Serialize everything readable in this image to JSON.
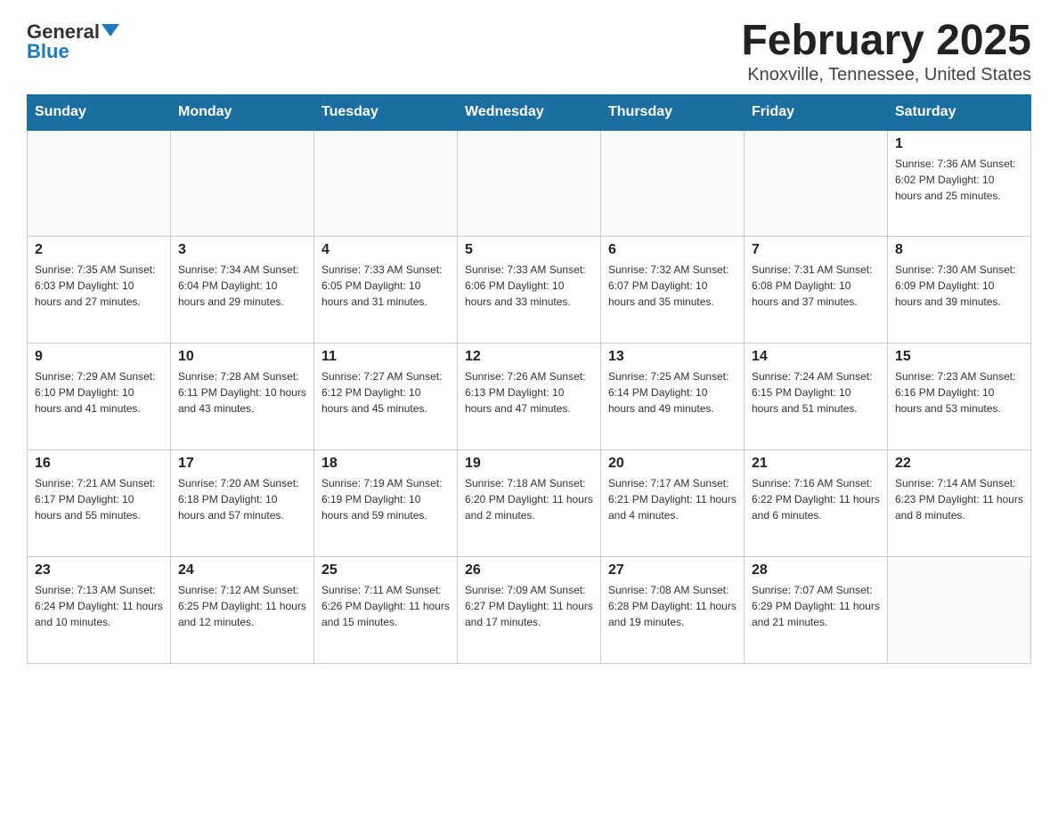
{
  "logo": {
    "general": "General",
    "blue": "Blue"
  },
  "title": "February 2025",
  "subtitle": "Knoxville, Tennessee, United States",
  "days_of_week": [
    "Sunday",
    "Monday",
    "Tuesday",
    "Wednesday",
    "Thursday",
    "Friday",
    "Saturday"
  ],
  "weeks": [
    [
      {
        "day": "",
        "info": ""
      },
      {
        "day": "",
        "info": ""
      },
      {
        "day": "",
        "info": ""
      },
      {
        "day": "",
        "info": ""
      },
      {
        "day": "",
        "info": ""
      },
      {
        "day": "",
        "info": ""
      },
      {
        "day": "1",
        "info": "Sunrise: 7:36 AM\nSunset: 6:02 PM\nDaylight: 10 hours\nand 25 minutes."
      }
    ],
    [
      {
        "day": "2",
        "info": "Sunrise: 7:35 AM\nSunset: 6:03 PM\nDaylight: 10 hours\nand 27 minutes."
      },
      {
        "day": "3",
        "info": "Sunrise: 7:34 AM\nSunset: 6:04 PM\nDaylight: 10 hours\nand 29 minutes."
      },
      {
        "day": "4",
        "info": "Sunrise: 7:33 AM\nSunset: 6:05 PM\nDaylight: 10 hours\nand 31 minutes."
      },
      {
        "day": "5",
        "info": "Sunrise: 7:33 AM\nSunset: 6:06 PM\nDaylight: 10 hours\nand 33 minutes."
      },
      {
        "day": "6",
        "info": "Sunrise: 7:32 AM\nSunset: 6:07 PM\nDaylight: 10 hours\nand 35 minutes."
      },
      {
        "day": "7",
        "info": "Sunrise: 7:31 AM\nSunset: 6:08 PM\nDaylight: 10 hours\nand 37 minutes."
      },
      {
        "day": "8",
        "info": "Sunrise: 7:30 AM\nSunset: 6:09 PM\nDaylight: 10 hours\nand 39 minutes."
      }
    ],
    [
      {
        "day": "9",
        "info": "Sunrise: 7:29 AM\nSunset: 6:10 PM\nDaylight: 10 hours\nand 41 minutes."
      },
      {
        "day": "10",
        "info": "Sunrise: 7:28 AM\nSunset: 6:11 PM\nDaylight: 10 hours\nand 43 minutes."
      },
      {
        "day": "11",
        "info": "Sunrise: 7:27 AM\nSunset: 6:12 PM\nDaylight: 10 hours\nand 45 minutes."
      },
      {
        "day": "12",
        "info": "Sunrise: 7:26 AM\nSunset: 6:13 PM\nDaylight: 10 hours\nand 47 minutes."
      },
      {
        "day": "13",
        "info": "Sunrise: 7:25 AM\nSunset: 6:14 PM\nDaylight: 10 hours\nand 49 minutes."
      },
      {
        "day": "14",
        "info": "Sunrise: 7:24 AM\nSunset: 6:15 PM\nDaylight: 10 hours\nand 51 minutes."
      },
      {
        "day": "15",
        "info": "Sunrise: 7:23 AM\nSunset: 6:16 PM\nDaylight: 10 hours\nand 53 minutes."
      }
    ],
    [
      {
        "day": "16",
        "info": "Sunrise: 7:21 AM\nSunset: 6:17 PM\nDaylight: 10 hours\nand 55 minutes."
      },
      {
        "day": "17",
        "info": "Sunrise: 7:20 AM\nSunset: 6:18 PM\nDaylight: 10 hours\nand 57 minutes."
      },
      {
        "day": "18",
        "info": "Sunrise: 7:19 AM\nSunset: 6:19 PM\nDaylight: 10 hours\nand 59 minutes."
      },
      {
        "day": "19",
        "info": "Sunrise: 7:18 AM\nSunset: 6:20 PM\nDaylight: 11 hours\nand 2 minutes."
      },
      {
        "day": "20",
        "info": "Sunrise: 7:17 AM\nSunset: 6:21 PM\nDaylight: 11 hours\nand 4 minutes."
      },
      {
        "day": "21",
        "info": "Sunrise: 7:16 AM\nSunset: 6:22 PM\nDaylight: 11 hours\nand 6 minutes."
      },
      {
        "day": "22",
        "info": "Sunrise: 7:14 AM\nSunset: 6:23 PM\nDaylight: 11 hours\nand 8 minutes."
      }
    ],
    [
      {
        "day": "23",
        "info": "Sunrise: 7:13 AM\nSunset: 6:24 PM\nDaylight: 11 hours\nand 10 minutes."
      },
      {
        "day": "24",
        "info": "Sunrise: 7:12 AM\nSunset: 6:25 PM\nDaylight: 11 hours\nand 12 minutes."
      },
      {
        "day": "25",
        "info": "Sunrise: 7:11 AM\nSunset: 6:26 PM\nDaylight: 11 hours\nand 15 minutes."
      },
      {
        "day": "26",
        "info": "Sunrise: 7:09 AM\nSunset: 6:27 PM\nDaylight: 11 hours\nand 17 minutes."
      },
      {
        "day": "27",
        "info": "Sunrise: 7:08 AM\nSunset: 6:28 PM\nDaylight: 11 hours\nand 19 minutes."
      },
      {
        "day": "28",
        "info": "Sunrise: 7:07 AM\nSunset: 6:29 PM\nDaylight: 11 hours\nand 21 minutes."
      },
      {
        "day": "",
        "info": ""
      }
    ]
  ]
}
